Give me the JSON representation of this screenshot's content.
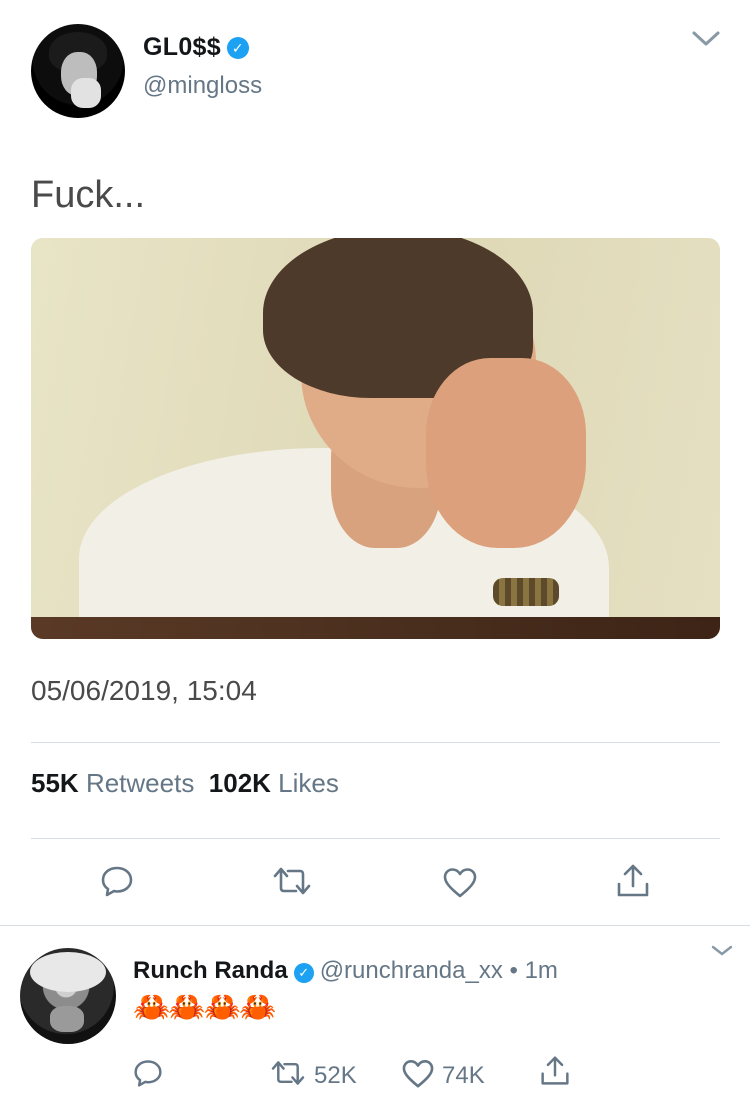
{
  "tweet": {
    "display_name": "GL0$$",
    "verified_mark": "✓",
    "handle": "@mingloss",
    "text": "Fuck...",
    "timestamp": "05/06/2019, 15:04",
    "stats": {
      "retweets_count": "55K",
      "retweets_label": "Retweets",
      "likes_count": "102K",
      "likes_label": "Likes"
    },
    "icons": [
      "chevron-down-icon",
      "reply-icon",
      "retweet-icon",
      "like-icon",
      "share-icon"
    ]
  },
  "reply": {
    "display_name": "Runch Randa",
    "verified_mark": "✓",
    "handle": "@runchranda_xx",
    "separator": "•",
    "time": "1m",
    "text": "🦀🦀🦀🦀",
    "retweets_count": "52K",
    "likes_count": "74K"
  },
  "colors": {
    "accent": "#1da1f2",
    "secondary_text": "#657786",
    "divider": "#d8dde2",
    "icon": "#657786"
  }
}
